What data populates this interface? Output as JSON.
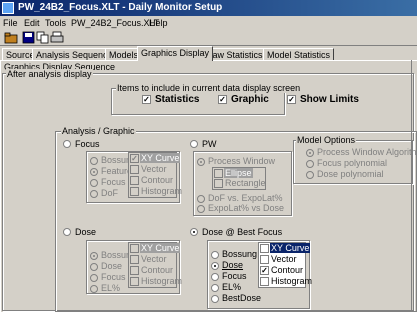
{
  "window": {
    "title": "PW_24B2_Focus.XLT - Daily Monitor Setup"
  },
  "menu": [
    "File",
    "Edit",
    "Tools",
    "PW_24B2_Focus.XLT",
    "Help"
  ],
  "toolbar": [
    "open-icon",
    "save-icon",
    "copy-icon",
    "print-icon"
  ],
  "tabs": [
    "Source",
    "Analysis Sequence",
    "Models",
    "Graphics Display",
    "Raw Statistics",
    "Model Statistics"
  ],
  "active_tab": "Graphics Display",
  "section_title": "Graphics Display Sequence",
  "subsection_title": "After analysis display",
  "items_group": {
    "caption": "Items to include in current data display screen",
    "statistics": "Statistics",
    "graphic": "Graphic",
    "show_limits": "Show Limits"
  },
  "analysis_group": {
    "caption": "Analysis / Graphic",
    "focus": {
      "label": "Focus",
      "radios": [
        "Bossung",
        "Feature",
        "Focus",
        "DoF"
      ],
      "checks": [
        "XY Curve",
        "Vector",
        "Contour",
        "Histogram"
      ]
    },
    "pw": {
      "label": "PW",
      "radios": [
        "Process Window",
        "DoF vs. ExpoLat%",
        "ExpoLat% vs Dose"
      ],
      "checks": [
        "Ellipse",
        "Rectangle"
      ]
    },
    "dose": {
      "label": "Dose",
      "radios": [
        "Bossung",
        "Dose",
        "Focus",
        "EL%"
      ],
      "checks": [
        "XY Curve",
        "Vector",
        "Contour",
        "Histogram"
      ]
    },
    "dose_best": {
      "label": "Dose @ Best Focus",
      "radios": [
        "Bossung",
        "Dose",
        "Focus",
        "EL%",
        "BestDose"
      ],
      "checks": [
        "XY Curve",
        "Vector",
        "Contour",
        "Histogram"
      ]
    }
  },
  "model_options": {
    "caption": "Model Options",
    "radios": [
      "Process Window Algorithm",
      "Focus polynomial",
      "Dose polynomial"
    ]
  }
}
